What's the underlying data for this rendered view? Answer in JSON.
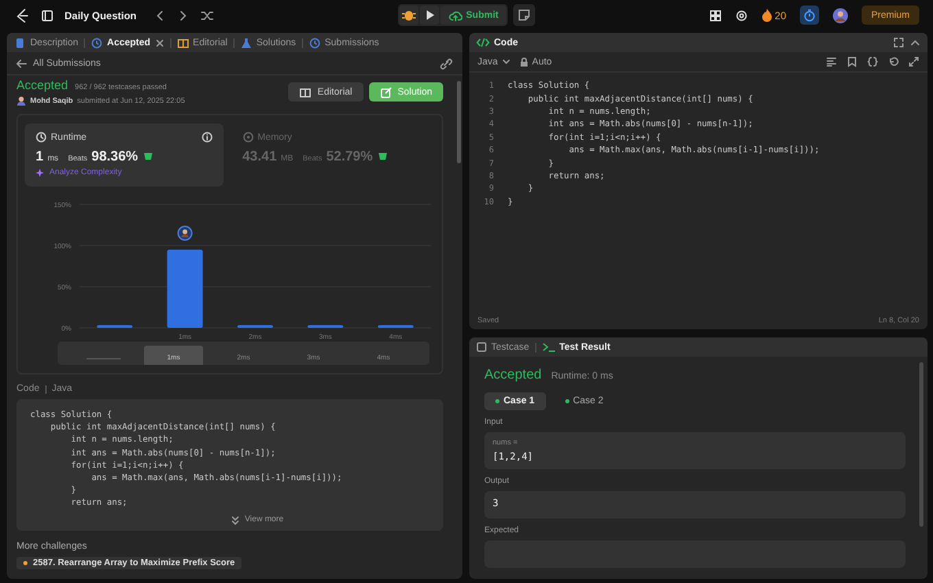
{
  "top_bar": {
    "title": "Daily Question",
    "submit": "Submit",
    "streak": "20",
    "premium": "Premium"
  },
  "left_panel": {
    "tabs": [
      {
        "label": "Description",
        "selected": false,
        "closable": false
      },
      {
        "label": "Accepted",
        "selected": true,
        "closable": true
      },
      {
        "label": "Editorial",
        "selected": false,
        "closable": false
      },
      {
        "label": "Solutions",
        "selected": false,
        "closable": false
      },
      {
        "label": "Submissions",
        "selected": false,
        "closable": false
      }
    ],
    "back_link": "All Submissions",
    "submission": {
      "status": "Accepted",
      "testcases": "962 / 962 testcases passed",
      "author": "Mohd Saqib",
      "submitted": "submitted at Jun 12, 2025 22:05",
      "buttons": [
        {
          "label": "Editorial",
          "kind": "secondary"
        },
        {
          "label": "Solution",
          "kind": "primary"
        }
      ]
    },
    "metrics": [
      {
        "title": "Runtime",
        "value": "1",
        "unit": "ms",
        "beats_label": "Beats",
        "beats": "98.36%",
        "selected": true,
        "link": "Analyze Complexity"
      },
      {
        "title": "Memory",
        "value": "43.41",
        "unit": "MB",
        "beats_label": "Beats",
        "beats": "52.79%",
        "selected": false
      }
    ],
    "chart_data": {
      "type": "bar",
      "categories": [
        null,
        "1ms",
        "2ms",
        "3ms",
        "4ms"
      ],
      "values": [
        3,
        95,
        2,
        2,
        2
      ],
      "ylim": [
        0,
        150
      ],
      "yticks": [
        {
          "value": 0,
          "label": "0%"
        },
        {
          "value": 50,
          "label": "50%"
        },
        {
          "value": 100,
          "label": "100%"
        },
        {
          "value": 150,
          "label": "150%"
        }
      ]
    },
    "overview": [
      {
        "selected": false
      },
      {
        "label": "1ms",
        "selected": true
      },
      {
        "label": "2ms",
        "selected": false
      },
      {
        "label": "3ms",
        "selected": false
      },
      {
        "label": "4ms",
        "selected": false
      }
    ],
    "code_section": {
      "title": "Code",
      "language": "Java",
      "view_more": "View more",
      "lines": [
        "class Solution {",
        "    public int maxAdjacentDistance(int[] nums) {",
        "        int n = nums.length;",
        "        int ans = Math.abs(nums[0] - nums[n-1]);",
        "        for(int i=1;i<n;i++) {",
        "            ans = Math.max(ans, Math.abs(nums[i-1]-nums[i]));",
        "        }",
        "        return ans;"
      ]
    },
    "more_challenges": {
      "title": "More challenges",
      "items": [
        "2587. Rearrange Array to Maximize Prefix Score"
      ]
    }
  },
  "code_panel": {
    "title": "Code",
    "language": "Java",
    "mode": "Auto",
    "status": "Saved",
    "cursor": "Ln 8, Col 20",
    "lines": [
      {
        "number": "1",
        "text": "class Solution {"
      },
      {
        "number": "2",
        "text": "    public int maxAdjacentDistance(int[] nums) {"
      },
      {
        "number": "3",
        "text": "        int n = nums.length;"
      },
      {
        "number": "4",
        "text": "        int ans = Math.abs(nums[0] - nums[n-1]);"
      },
      {
        "number": "5",
        "text": "        for(int i=1;i<n;i++) {"
      },
      {
        "number": "6",
        "text": "            ans = Math.max(ans, Math.abs(nums[i-1]-nums[i]));"
      },
      {
        "number": "7",
        "text": "        }"
      },
      {
        "number": "8",
        "text": "        return ans;"
      },
      {
        "number": "9",
        "text": "    }"
      },
      {
        "number": "10",
        "text": "}"
      }
    ]
  },
  "test_panel": {
    "tabs": [
      {
        "label": "Testcase",
        "selected": false
      },
      {
        "label": "Test Result",
        "selected": true
      }
    ],
    "status": "Accepted",
    "runtime": "Runtime: 0 ms",
    "cases": [
      {
        "label": "Case 1",
        "selected": true
      },
      {
        "label": "Case 2",
        "selected": false
      }
    ],
    "sections": [
      {
        "label": "Input",
        "variable": "nums =",
        "value": "[1,2,4]"
      },
      {
        "label": "Output",
        "value": "3"
      },
      {
        "label": "Expected"
      }
    ]
  }
}
